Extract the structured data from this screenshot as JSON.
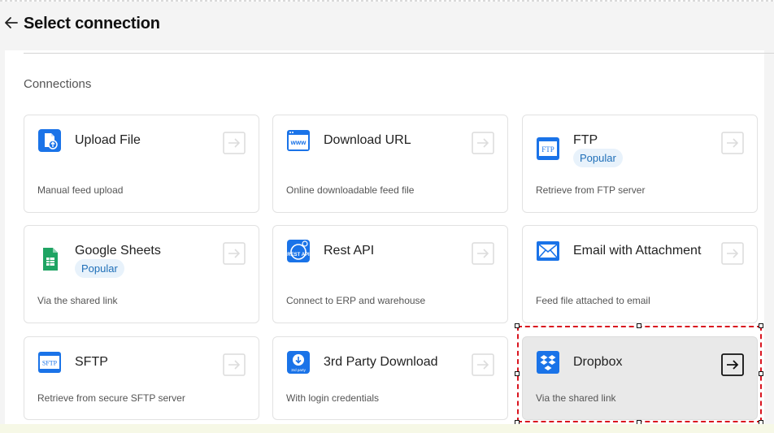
{
  "header": {
    "title": "Select connection"
  },
  "section_label": "Connections",
  "colors": {
    "accent_blue": "#1a73e8",
    "sheets_green": "#1fa463",
    "selection_red": "#d9141f"
  },
  "cards": [
    {
      "title": "Upload File",
      "description": "Manual feed upload",
      "icon": "upload-file-icon",
      "badge": ""
    },
    {
      "title": "Download URL",
      "description": "Online downloadable feed file",
      "icon": "www-icon",
      "badge": ""
    },
    {
      "title": "FTP",
      "description": "Retrieve from FTP server",
      "icon": "ftp-icon",
      "badge": "Popular"
    },
    {
      "title": "Google Sheets",
      "description": "Via the shared link",
      "icon": "google-sheets-icon",
      "badge": "Popular"
    },
    {
      "title": "Rest API",
      "description": "Connect to ERP and warehouse",
      "icon": "rest-api-icon",
      "badge": "",
      "icon_text": "REST API"
    },
    {
      "title": "Email with Attachment",
      "description": "Feed file attached to email",
      "icon": "mail-icon",
      "badge": ""
    },
    {
      "title": "SFTP",
      "description": "Retrieve from secure SFTP server",
      "icon": "sftp-icon",
      "badge": "",
      "icon_text": "SFTP"
    },
    {
      "title": "3rd Party Download",
      "description": "With login credentials",
      "icon": "third-party-download-icon",
      "badge": "",
      "icon_text": "3rd party"
    },
    {
      "title": "Dropbox",
      "description": "Via the shared link",
      "icon": "dropbox-icon",
      "badge": "",
      "selected": true
    }
  ],
  "icon_labels": {
    "www": "www",
    "ftp": "FTP"
  }
}
